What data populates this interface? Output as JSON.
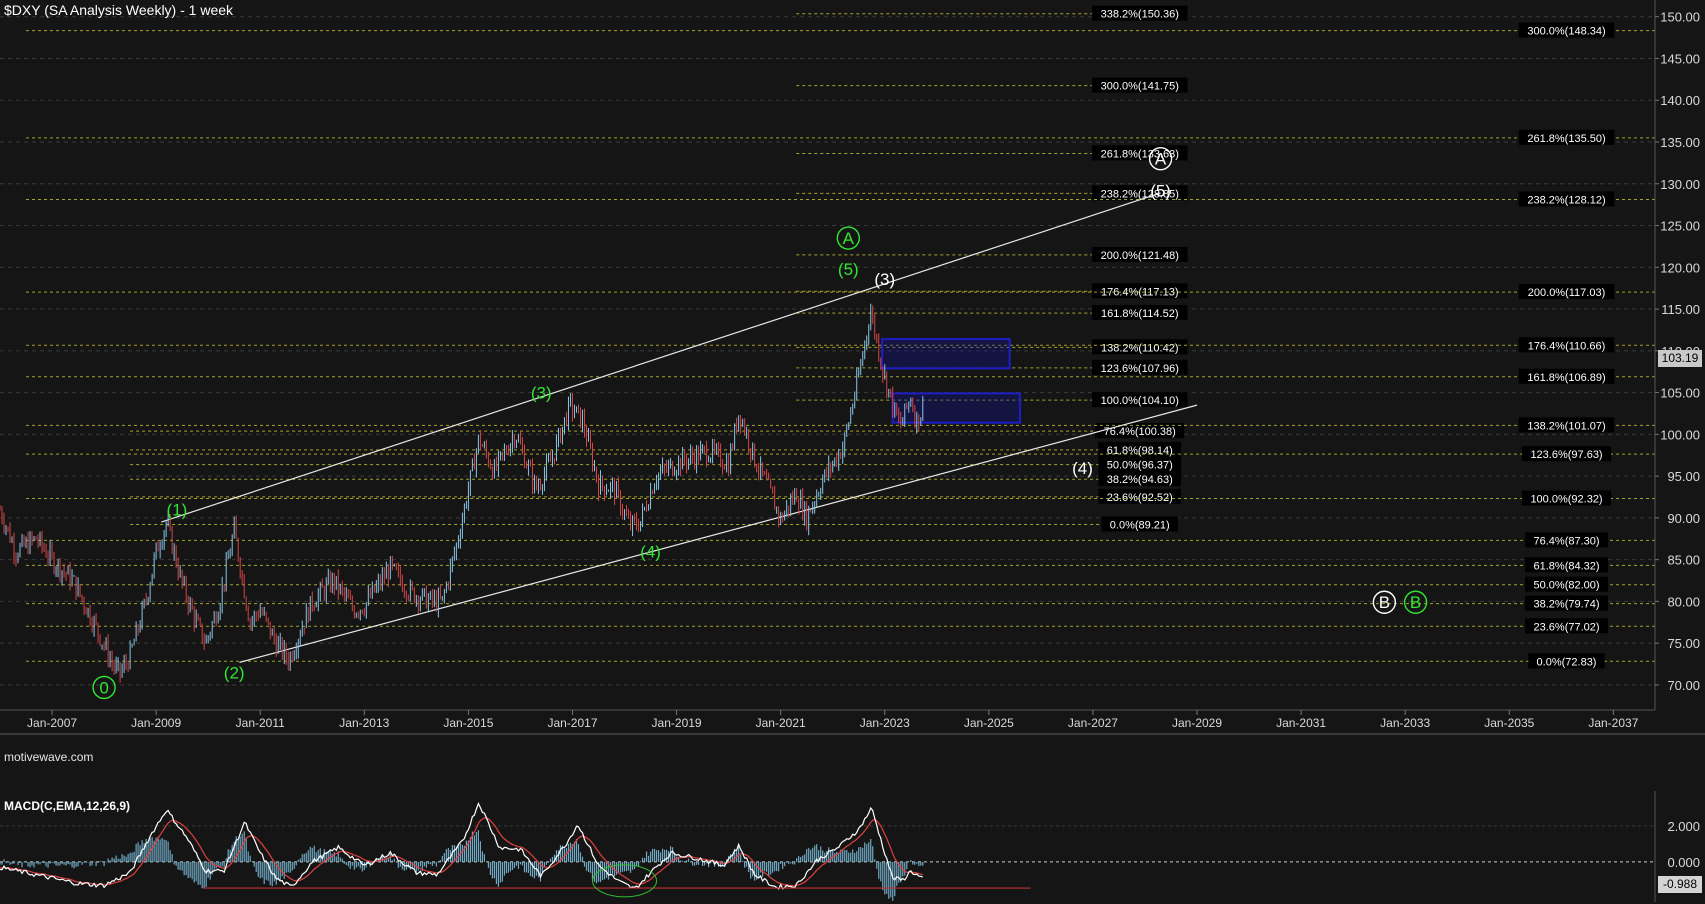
{
  "header": {
    "title": "$DXY (SA Analysis Weekly) - 1 week",
    "watermark": "motivewave.com",
    "macd_label": "MACD(C,EMA,12,26,9)"
  },
  "price_axis": {
    "last_price": "103.19",
    "ticks": [
      "70.00",
      "75.00",
      "80.00",
      "85.00",
      "90.00",
      "95.00",
      "100.00",
      "105.00",
      "110.00",
      "115.00",
      "120.00",
      "125.00",
      "130.00",
      "135.00",
      "140.00",
      "145.00",
      "150.00"
    ]
  },
  "macd_axis": {
    "ticks": [
      "2.000",
      "0.000"
    ],
    "last_value": "-0.988"
  },
  "time_axis": {
    "labels": [
      "Jan-2007",
      "Jan-2009",
      "Jan-2011",
      "Jan-2013",
      "Jan-2015",
      "Jan-2017",
      "Jan-2019",
      "Jan-2021",
      "Jan-2023",
      "Jan-2025",
      "Jan-2027",
      "Jan-2029",
      "Jan-2031",
      "Jan-2033",
      "Jan-2035",
      "Jan-2037"
    ]
  },
  "colors": {
    "background": "#151515",
    "wave_green": "#33e633",
    "wave_white": "#ffffff",
    "up_bar": "#87c5e8",
    "down_bar": "#d54545",
    "fib_line": "#a5a52a",
    "target_box": "#1e1ec8",
    "macd_line": "#ffffff",
    "signal_line": "#e04040",
    "histogram": "#6fa9c4"
  },
  "chart_data": {
    "type": "line",
    "title": "$DXY (SA Analysis Weekly) - 1 week",
    "ylim": [
      67,
      152
    ],
    "xlim": [
      2006.0,
      2037.8
    ],
    "price_path": [
      [
        2006.0,
        91.0
      ],
      [
        2006.3,
        86.0
      ],
      [
        2006.7,
        87.5
      ],
      [
        2007.0,
        85.0
      ],
      [
        2007.4,
        82.5
      ],
      [
        2007.8,
        77.5
      ],
      [
        2008.2,
        72.0
      ],
      [
        2008.3,
        71.3
      ],
      [
        2008.5,
        73.5
      ],
      [
        2008.8,
        80.0
      ],
      [
        2009.0,
        86.0
      ],
      [
        2009.2,
        89.5
      ],
      [
        2009.5,
        82.0
      ],
      [
        2009.8,
        77.0
      ],
      [
        2009.95,
        75.0
      ],
      [
        2010.2,
        79.5
      ],
      [
        2010.5,
        88.5
      ],
      [
        2010.8,
        77.5
      ],
      [
        2011.0,
        79.0
      ],
      [
        2011.3,
        75.0
      ],
      [
        2011.55,
        73.0
      ],
      [
        2011.8,
        77.0
      ],
      [
        2012.0,
        80.0
      ],
      [
        2012.4,
        82.5
      ],
      [
        2012.8,
        79.0
      ],
      [
        2013.0,
        79.5
      ],
      [
        2013.5,
        84.0
      ],
      [
        2013.9,
        81.0
      ],
      [
        2014.3,
        80.0
      ],
      [
        2014.5,
        80.0
      ],
      [
        2014.8,
        87.5
      ],
      [
        2015.2,
        99.5
      ],
      [
        2015.5,
        95.5
      ],
      [
        2015.9,
        100.2
      ],
      [
        2016.3,
        93.5
      ],
      [
        2016.6,
        97.0
      ],
      [
        2016.95,
        103.5
      ],
      [
        2017.2,
        101.5
      ],
      [
        2017.5,
        94.0
      ],
      [
        2017.8,
        93.5
      ],
      [
        2018.1,
        89.0
      ],
      [
        2018.3,
        89.5
      ],
      [
        2018.6,
        95.0
      ],
      [
        2019.0,
        96.5
      ],
      [
        2019.6,
        98.0
      ],
      [
        2020.0,
        96.5
      ],
      [
        2020.2,
        102.8
      ],
      [
        2020.5,
        97.0
      ],
      [
        2020.8,
        93.0
      ],
      [
        2021.0,
        89.8
      ],
      [
        2021.3,
        93.0
      ],
      [
        2021.5,
        90.0
      ],
      [
        2021.8,
        94.5
      ],
      [
        2022.2,
        98.5
      ],
      [
        2022.5,
        107.0
      ],
      [
        2022.73,
        114.8
      ],
      [
        2022.95,
        108.0
      ],
      [
        2023.2,
        102.5
      ],
      [
        2023.3,
        101.0
      ],
      [
        2023.5,
        104.5
      ],
      [
        2023.6,
        101.5
      ],
      [
        2023.75,
        103.19
      ]
    ],
    "channel_lines": [
      {
        "from": [
          2009.1,
          89.5
        ],
        "to": [
          2028.3,
          128.9
        ]
      },
      {
        "from": [
          2010.6,
          72.7
        ],
        "to": [
          2029.0,
          103.5
        ]
      }
    ],
    "fib_levels_center": [
      {
        "label": "338.2%(150.36)",
        "value": 150.36
      },
      {
        "label": "300.0%(141.75)",
        "value": 141.75
      },
      {
        "label": "261.8%(133.63)",
        "value": 133.63
      },
      {
        "label": "238.2%(128.85)",
        "value": 128.85
      },
      {
        "label": "200.0%(121.48)",
        "value": 121.48
      },
      {
        "label": "176.4%(117.13)",
        "value": 117.13
      },
      {
        "label": "161.8%(114.52)",
        "value": 114.52
      },
      {
        "label": "138.2%(110.42)",
        "value": 110.42
      },
      {
        "label": "123.6%(107.96)",
        "value": 107.96
      },
      {
        "label": "100.0%(104.10)",
        "value": 104.1
      },
      {
        "label": "76.4%(100.38)",
        "value": 100.38
      },
      {
        "label": "61.8%(98.14)",
        "value": 98.14
      },
      {
        "label": "50.0%(96.37)",
        "value": 96.37
      },
      {
        "label": "38.2%(94.63)",
        "value": 94.63
      },
      {
        "label": "23.6%(92.52)",
        "value": 92.52
      },
      {
        "label": "0.0%(89.21)",
        "value": 89.21
      }
    ],
    "fib_levels_right": [
      {
        "label": "300.0%(148.34)",
        "value": 148.34
      },
      {
        "label": "261.8%(135.50)",
        "value": 135.5
      },
      {
        "label": "238.2%(128.12)",
        "value": 128.12
      },
      {
        "label": "200.0%(117.03)",
        "value": 117.03
      },
      {
        "label": "176.4%(110.66)",
        "value": 110.66
      },
      {
        "label": "161.8%(106.89)",
        "value": 106.89
      },
      {
        "label": "138.2%(101.07)",
        "value": 101.07
      },
      {
        "label": "123.6%(97.63)",
        "value": 97.63
      },
      {
        "label": "100.0%(92.32)",
        "value": 92.32
      },
      {
        "label": "76.4%(87.30)",
        "value": 87.3
      },
      {
        "label": "61.8%(84.32)",
        "value": 84.32
      },
      {
        "label": "50.0%(82.00)",
        "value": 82.0
      },
      {
        "label": "38.2%(79.74)",
        "value": 79.74
      },
      {
        "label": "23.6%(77.02)",
        "value": 77.02
      },
      {
        "label": "0.0%(72.83)",
        "value": 72.83
      }
    ],
    "target_boxes": [
      {
        "x": [
          2022.95,
          2025.4
        ],
        "y": [
          107.9,
          111.4
        ]
      },
      {
        "x": [
          2023.15,
          2025.6
        ],
        "y": [
          101.4,
          104.9
        ]
      }
    ],
    "wave_labels": [
      {
        "text": "0",
        "circled": true,
        "color": "green",
        "x": 2008.0,
        "y": 69.7
      },
      {
        "text": "(1)",
        "circled": false,
        "color": "green",
        "x": 2009.4,
        "y": 91.0
      },
      {
        "text": "(2)",
        "circled": false,
        "color": "green",
        "x": 2010.5,
        "y": 71.5
      },
      {
        "text": "(3)",
        "circled": false,
        "color": "green",
        "x": 2016.4,
        "y": 105.0
      },
      {
        "text": "(4)",
        "circled": false,
        "color": "green",
        "x": 2018.5,
        "y": 86.0
      },
      {
        "text": "A",
        "circled": true,
        "color": "green",
        "x": 2022.3,
        "y": 123.5
      },
      {
        "text": "(5)",
        "circled": false,
        "color": "green",
        "x": 2022.3,
        "y": 119.8
      },
      {
        "text": "(3)",
        "circled": false,
        "color": "white",
        "x": 2023.0,
        "y": 118.6
      },
      {
        "text": "(4)",
        "circled": false,
        "color": "white",
        "x": 2026.8,
        "y": 96.0
      },
      {
        "text": "A",
        "circled": true,
        "color": "white",
        "x": 2028.3,
        "y": 133.0
      },
      {
        "text": "(5)",
        "circled": false,
        "color": "white",
        "x": 2028.3,
        "y": 129.2
      },
      {
        "text": "B",
        "circled": true,
        "color": "white",
        "x": 2032.6,
        "y": 79.9
      },
      {
        "text": "B",
        "circled": true,
        "color": "green",
        "x": 2033.2,
        "y": 79.9
      }
    ],
    "macd": {
      "ylim": [
        -2.0,
        3.6
      ],
      "zero": 0.0,
      "points": [
        [
          2006.0,
          -0.3
        ],
        [
          2006.5,
          -0.6
        ],
        [
          2007.0,
          -0.9
        ],
        [
          2007.5,
          -1.2
        ],
        [
          2008.0,
          -1.3
        ],
        [
          2008.5,
          -0.6
        ],
        [
          2008.9,
          1.5
        ],
        [
          2009.2,
          2.9
        ],
        [
          2009.6,
          1.3
        ],
        [
          2009.95,
          -0.5
        ],
        [
          2010.3,
          -0.5
        ],
        [
          2010.7,
          2.2
        ],
        [
          2011.0,
          0.5
        ],
        [
          2011.3,
          -0.9
        ],
        [
          2011.6,
          -1.4
        ],
        [
          2012.0,
          0.0
        ],
        [
          2012.5,
          0.8
        ],
        [
          2013.0,
          -0.2
        ],
        [
          2013.5,
          0.5
        ],
        [
          2014.0,
          -0.6
        ],
        [
          2014.4,
          -0.7
        ],
        [
          2014.9,
          1.2
        ],
        [
          2015.2,
          3.3
        ],
        [
          2015.6,
          0.8
        ],
        [
          2016.0,
          0.7
        ],
        [
          2016.4,
          -0.8
        ],
        [
          2016.9,
          1.1
        ],
        [
          2017.1,
          2.1
        ],
        [
          2017.5,
          -0.2
        ],
        [
          2017.9,
          -1.1
        ],
        [
          2018.2,
          -1.5
        ],
        [
          2018.6,
          -0.3
        ],
        [
          2018.9,
          0.5
        ],
        [
          2019.4,
          0.2
        ],
        [
          2019.9,
          -0.2
        ],
        [
          2020.2,
          0.9
        ],
        [
          2020.5,
          -0.7
        ],
        [
          2020.9,
          -1.4
        ],
        [
          2021.3,
          -1.3
        ],
        [
          2021.7,
          0.1
        ],
        [
          2022.1,
          0.8
        ],
        [
          2022.5,
          1.8
        ],
        [
          2022.75,
          3.0
        ],
        [
          2022.95,
          1.0
        ],
        [
          2023.15,
          -0.9
        ],
        [
          2023.35,
          -1.0
        ],
        [
          2023.5,
          -0.5
        ],
        [
          2023.75,
          -0.988
        ]
      ]
    }
  }
}
